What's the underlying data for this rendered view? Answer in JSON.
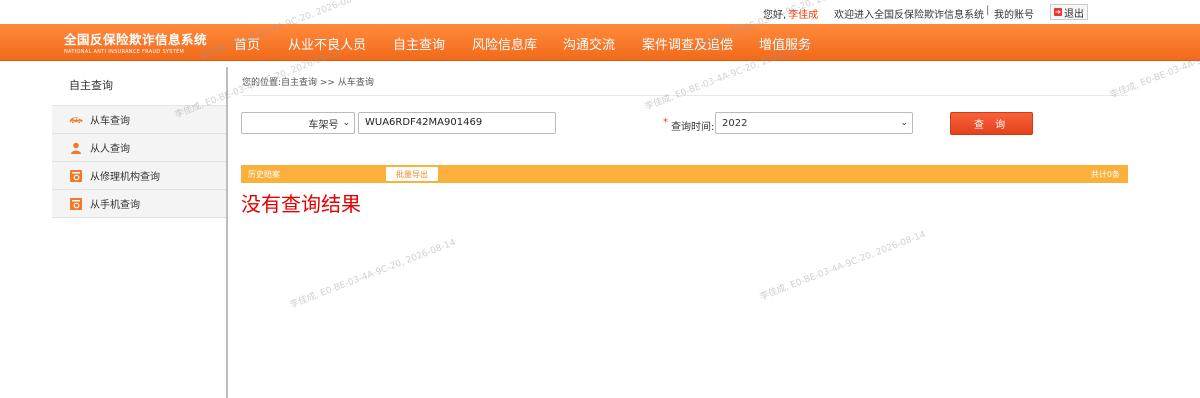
{
  "topbar": {
    "greeting": "您好,",
    "username": "李佳成",
    "welcome": "欢迎进入全国反保险欺诈信息系统",
    "separator": "|",
    "my_account": "我的账号",
    "logout": "退出"
  },
  "logo": {
    "title_cn": "全国反保险欺诈信息系统",
    "title_en": "NATIONAL ANTI INSURANCE FRAUD SYSTEM"
  },
  "nav": {
    "items": [
      {
        "label": "首页"
      },
      {
        "label": "从业不良人员"
      },
      {
        "label": "自主查询"
      },
      {
        "label": "风险信息库"
      },
      {
        "label": "沟通交流"
      },
      {
        "label": "案件调查及追偿"
      },
      {
        "label": "增值服务"
      }
    ]
  },
  "sidebar": {
    "title": "自主查询",
    "items": [
      {
        "label": "从车查询",
        "icon": "car-icon"
      },
      {
        "label": "从人查询",
        "icon": "person-icon"
      },
      {
        "label": "从修理机构查询",
        "icon": "repair-shop-icon"
      },
      {
        "label": "从手机查询",
        "icon": "phone-icon"
      }
    ]
  },
  "main": {
    "breadcrumb": "您的位置:自主查询 >> 从车查询",
    "search": {
      "type_select": "车架号",
      "vin_value": "WUA6RDF42MA901469",
      "required_mark": "*",
      "time_label": "查询时间:",
      "time_value": "2022",
      "query_button": "查 询"
    },
    "results": {
      "history_label": "历史赔案",
      "export_button": "批量导出",
      "total": "共计0条",
      "empty_message": "没有查询结果"
    }
  },
  "colors": {
    "nav_orange": "#f26a1b",
    "result_bar": "#fbb03b",
    "query_button": "#e4421b",
    "empty_text": "#e50000"
  },
  "watermark": "李佳成, E0-BE-03-4A-9C-20, 2026-08-14"
}
